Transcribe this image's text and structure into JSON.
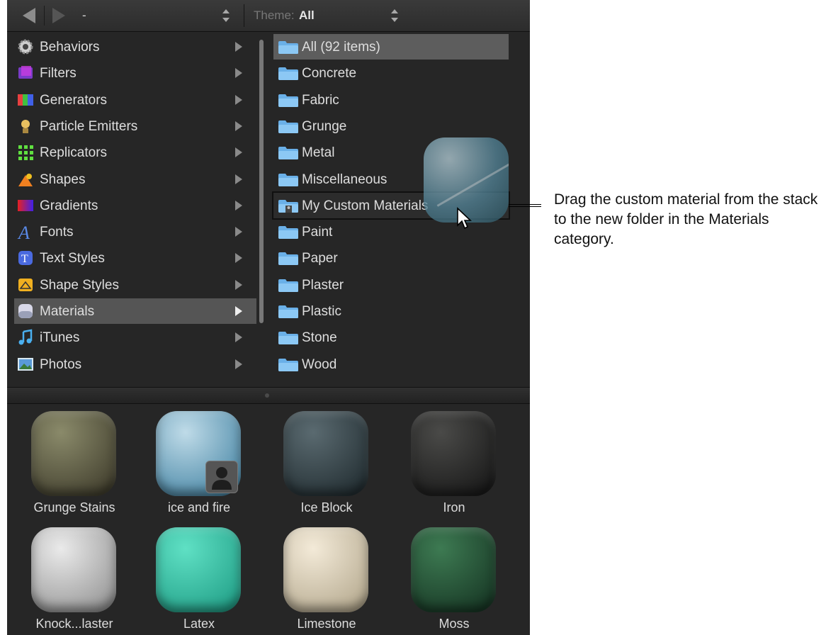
{
  "toolbar": {
    "path_value": "-",
    "theme_label": "Theme:",
    "theme_value": "All"
  },
  "categories": [
    {
      "label": "Behaviors",
      "icon": "gear-icon"
    },
    {
      "label": "Filters",
      "icon": "filters-icon"
    },
    {
      "label": "Generators",
      "icon": "generators-icon"
    },
    {
      "label": "Particle Emitters",
      "icon": "particle-emitters-icon"
    },
    {
      "label": "Replicators",
      "icon": "replicators-icon"
    },
    {
      "label": "Shapes",
      "icon": "shapes-icon"
    },
    {
      "label": "Gradients",
      "icon": "gradients-icon"
    },
    {
      "label": "Fonts",
      "icon": "fonts-icon"
    },
    {
      "label": "Text Styles",
      "icon": "text-styles-icon"
    },
    {
      "label": "Shape Styles",
      "icon": "shape-styles-icon"
    },
    {
      "label": "Materials",
      "icon": "materials-icon",
      "selected": true
    },
    {
      "label": "iTunes",
      "icon": "itunes-icon"
    },
    {
      "label": "Photos",
      "icon": "photos-icon"
    }
  ],
  "folders": [
    {
      "label": "All (92 items)",
      "selected": true
    },
    {
      "label": "Concrete"
    },
    {
      "label": "Fabric"
    },
    {
      "label": "Grunge"
    },
    {
      "label": "Metal"
    },
    {
      "label": "Miscellaneous"
    },
    {
      "label": "My Custom Materials",
      "drop_target": true
    },
    {
      "label": "Paint"
    },
    {
      "label": "Paper"
    },
    {
      "label": "Plaster"
    },
    {
      "label": "Plastic"
    },
    {
      "label": "Stone"
    },
    {
      "label": "Wood"
    }
  ],
  "materials": [
    {
      "label": "Grunge Stains",
      "colors": [
        "#8a8a6a",
        "#3d3a2a"
      ]
    },
    {
      "label": "ice and fire",
      "colors": [
        "#bfdbe8",
        "#3d7fa0"
      ],
      "custom": true
    },
    {
      "label": "Ice Block",
      "colors": [
        "#5a6a70",
        "#1f2a2e"
      ]
    },
    {
      "label": "Iron",
      "colors": [
        "#4a4a48",
        "#161616"
      ]
    },
    {
      "label": "Knock...laster",
      "colors": [
        "#eaeaea",
        "#8f8f8f"
      ]
    },
    {
      "label": "Latex",
      "colors": [
        "#5fe0c4",
        "#1e9c84"
      ]
    },
    {
      "label": "Limestone",
      "colors": [
        "#f3ead8",
        "#b1a58a"
      ]
    },
    {
      "label": "Moss",
      "colors": [
        "#3d7a52",
        "#153322"
      ]
    }
  ],
  "callout": {
    "text": "Drag the custom material from the stack to the new folder in the Materials category."
  }
}
